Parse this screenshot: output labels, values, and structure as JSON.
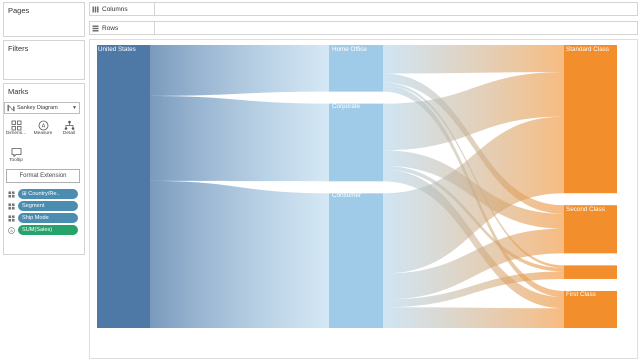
{
  "panels": {
    "pages": "Pages",
    "filters": "Filters",
    "marks": "Marks"
  },
  "marks_card": {
    "mark_type": "Sankey Diagram",
    "buttons": {
      "dimensions": "Dimens...",
      "measure": "Measure",
      "detail": "Detail",
      "tooltip": "Tooltip"
    },
    "format_extension": "Format Extension",
    "pills": [
      {
        "label": "Country/Re..",
        "kind": "dimension",
        "icon": "plus-box-icon"
      },
      {
        "label": "Segment",
        "kind": "dimension",
        "icon": "detail-icon"
      },
      {
        "label": "Ship Mode",
        "kind": "dimension",
        "icon": "detail-icon"
      },
      {
        "label": "SUM(Sales)",
        "kind": "measure",
        "icon": "measure-icon"
      }
    ]
  },
  "shelves": {
    "columns": "Columns",
    "rows": "Rows"
  },
  "colors": {
    "country": "#4e79a7",
    "segment": "#a0cbe8",
    "shipmode": "#f28e2b",
    "pill_dimension": "#4a8db0",
    "pill_measure": "#26a36b"
  },
  "chart_data": {
    "type": "sankey",
    "stages": [
      "Country/Region",
      "Segment",
      "Ship Mode"
    ],
    "nodes": {
      "country": [
        "United States"
      ],
      "segment": [
        "Home Office",
        "Corporate",
        "Consumer"
      ],
      "shipmode": [
        "Standard Class",
        "Second Class",
        "Same Day",
        "First Class"
      ]
    },
    "node_labels": {
      "united_states": "United States",
      "home_office": "Home Office",
      "corporate": "Corporate",
      "consumer": "Consumer",
      "standard_class": "Standard Class",
      "second_class": "Second Class",
      "first_class": "First Class"
    },
    "country_to_segment": [
      {
        "from": "United States",
        "to": "Home Office",
        "value": 18
      },
      {
        "from": "United States",
        "to": "Corporate",
        "value": 30
      },
      {
        "from": "United States",
        "to": "Consumer",
        "value": 52
      }
    ],
    "segment_to_shipmode": [
      {
        "from": "Home Office",
        "to": "Standard Class",
        "value": 11
      },
      {
        "from": "Home Office",
        "to": "Second Class",
        "value": 3.5
      },
      {
        "from": "Home Office",
        "to": "Same Day",
        "value": 1
      },
      {
        "from": "Home Office",
        "to": "First Class",
        "value": 2.5
      },
      {
        "from": "Corporate",
        "to": "Standard Class",
        "value": 18
      },
      {
        "from": "Corporate",
        "to": "Second Class",
        "value": 6
      },
      {
        "from": "Corporate",
        "to": "Same Day",
        "value": 1.5
      },
      {
        "from": "Corporate",
        "to": "First Class",
        "value": 4.5
      },
      {
        "from": "Consumer",
        "to": "Standard Class",
        "value": 31
      },
      {
        "from": "Consumer",
        "to": "Second Class",
        "value": 10
      },
      {
        "from": "Consumer",
        "to": "Same Day",
        "value": 3
      },
      {
        "from": "Consumer",
        "to": "First Class",
        "value": 8
      }
    ]
  }
}
